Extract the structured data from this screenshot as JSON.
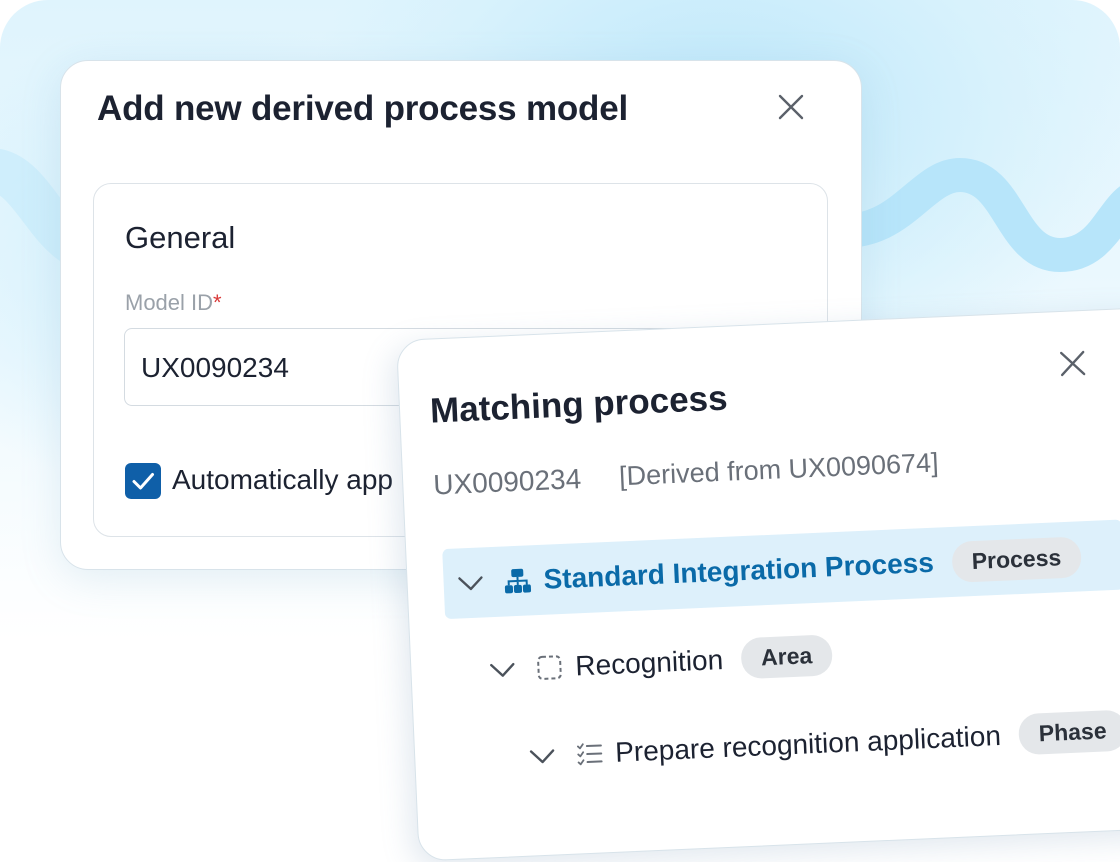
{
  "colors": {
    "accent": "#0f5fa8",
    "highlight_row": "#ddf0fb",
    "link_text": "#0a6aa8",
    "required": "#d93838",
    "badge_bg": "#e4e7ea"
  },
  "dialog_add": {
    "title": "Add new derived process model",
    "close_icon": "close-icon",
    "general": {
      "title": "General",
      "model_id_label": "Model ID",
      "required_mark": "*",
      "model_id_value": "UX0090234",
      "auto_checkbox_checked": true,
      "auto_checkbox_label": "Automatically app"
    }
  },
  "dialog_matching": {
    "title": "Matching process",
    "close_icon": "close-icon",
    "model_id": "UX0090234",
    "derived_from": "[Derived from UX0090674]",
    "tree": [
      {
        "label": "Standard Integration Process",
        "badge": "Process",
        "icon": "hierarchy-icon",
        "expanded": true,
        "selected": true
      },
      {
        "label": "Recognition",
        "badge": "Area",
        "icon": "dashed-square-icon",
        "expanded": true
      },
      {
        "label": "Prepare recognition application",
        "badge": "Phase",
        "icon": "checklist-icon",
        "expanded": true
      }
    ]
  }
}
